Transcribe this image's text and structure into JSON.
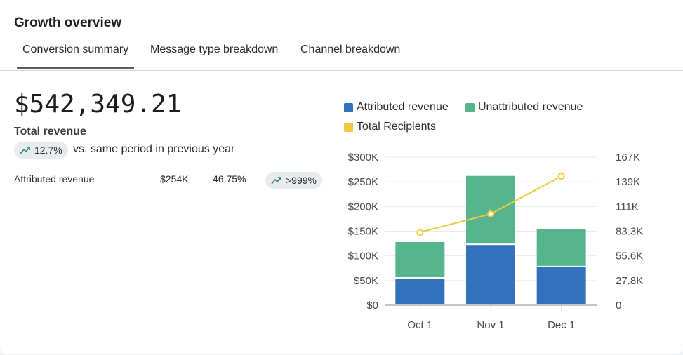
{
  "header": {
    "title": "Growth overview"
  },
  "tabs": [
    {
      "label": "Conversion summary",
      "active": true
    },
    {
      "label": "Message type breakdown",
      "active": false
    },
    {
      "label": "Channel breakdown",
      "active": false
    }
  ],
  "summary": {
    "total_value": "$542,349.21",
    "total_label": "Total revenue",
    "change_badge": "12.7%",
    "change_icon": "trending-up-icon",
    "comparison_text": "vs. same period in previous year",
    "rows": [
      {
        "label": "Attributed revenue",
        "value": "$254K",
        "percent": "46.75%",
        "change": ">999%"
      }
    ]
  },
  "colors": {
    "attributed": "#3272bb",
    "unattributed": "#56b58d",
    "recipients": "#f0c93c",
    "trend_up": "#2e8b57"
  },
  "chart_data": {
    "type": "bar",
    "stacked": true,
    "categories": [
      "Oct 1",
      "Nov 1",
      "Dec 1"
    ],
    "series": [
      {
        "name": "Attributed revenue",
        "type": "bar",
        "axis": "left",
        "values": [
          54000,
          122000,
          77000
        ]
      },
      {
        "name": "Unattributed revenue",
        "type": "bar",
        "axis": "left",
        "values": [
          74000,
          140000,
          77000
        ]
      },
      {
        "name": "Total Recipients",
        "type": "line",
        "axis": "right",
        "values": [
          82300,
          102900,
          145600
        ]
      }
    ],
    "y_left": {
      "ylim": [
        0,
        300000
      ],
      "ticks": [
        "$0",
        "$50K",
        "$100K",
        "$150K",
        "$200K",
        "$250K",
        "$300K"
      ]
    },
    "y_right": {
      "ylim": [
        0,
        167000
      ],
      "ticks": [
        "0",
        "27.8K",
        "55.6K",
        "83.3K",
        "111K",
        "139K",
        "167K"
      ]
    },
    "legend": [
      "Attributed revenue",
      "Unattributed revenue",
      "Total Recipients"
    ],
    "legend_position": "top",
    "grid": true
  }
}
